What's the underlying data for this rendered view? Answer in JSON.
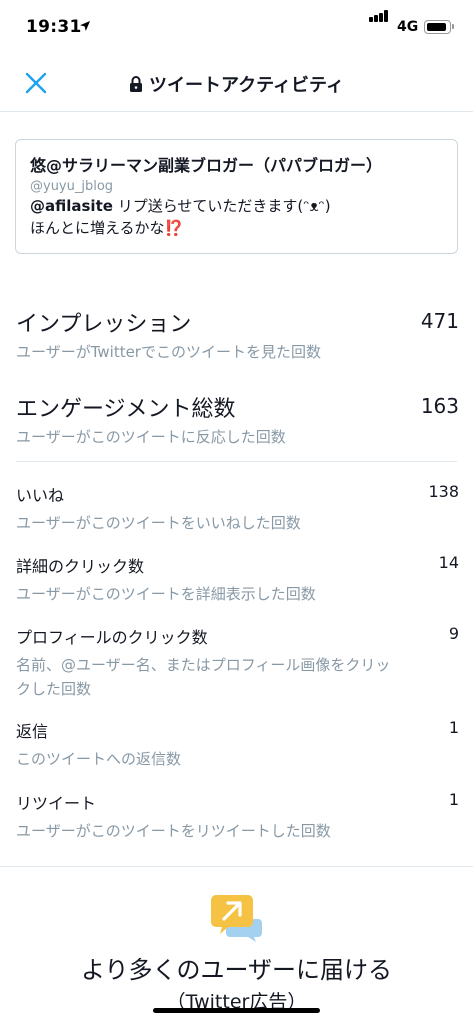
{
  "status_bar": {
    "time": "19:31",
    "network": "4G",
    "location_icon": "location-arrow-icon",
    "signal_icon": "signal-bars-icon",
    "battery_icon": "battery-icon"
  },
  "nav": {
    "title": "ツイートアクティビティ",
    "close_icon": "close-icon",
    "lock_icon": "lock-icon",
    "accent_color": "#1da1f2"
  },
  "tweet": {
    "author_name": "悠@サラリーマン副業ブロガー（パパブロガー）",
    "handle": "@yuyu_jblog",
    "mention": "@afilasite",
    "text_line1": " リプ送らせていただきます(ᵔᴥᵔ)",
    "text_line2": "ほんとに増えるかな⁉️"
  },
  "metrics": {
    "impressions": {
      "label": "インプレッション",
      "value": "471",
      "description": "ユーザーがTwitterでこのツイートを見た回数"
    },
    "engagements": {
      "label": "エンゲージメント総数",
      "value": "163",
      "description": "ユーザーがこのツイートに反応した回数"
    },
    "likes": {
      "label": "いいね",
      "value": "138",
      "description": "ユーザーがこのツイートをいいねした回数"
    },
    "detail_clicks": {
      "label": "詳細のクリック数",
      "value": "14",
      "description": "ユーザーがこのツイートを詳細表示した回数"
    },
    "profile_clicks": {
      "label": "プロフィールのクリック数",
      "value": "9",
      "description_line1": "名前、@ユーザー名、またはプロフィール画像をクリッ",
      "description_line2": "クした回数"
    },
    "replies": {
      "label": "返信",
      "value": "1",
      "description": "このツイートへの返信数"
    },
    "retweets": {
      "label": "リツイート",
      "value": "1",
      "description": "ユーザーがこのツイートをリツイートした回数"
    }
  },
  "promo": {
    "icon": "promote-tweet-icon",
    "title": "より多くのユーザーに届ける",
    "subtitle": "（Twitter広告）"
  },
  "colors": {
    "text_primary": "#141823",
    "text_secondary": "#8899a6",
    "divider": "#e1e8ed",
    "promo_yellow": "#f5c243",
    "promo_blue": "#a5d1f0"
  }
}
